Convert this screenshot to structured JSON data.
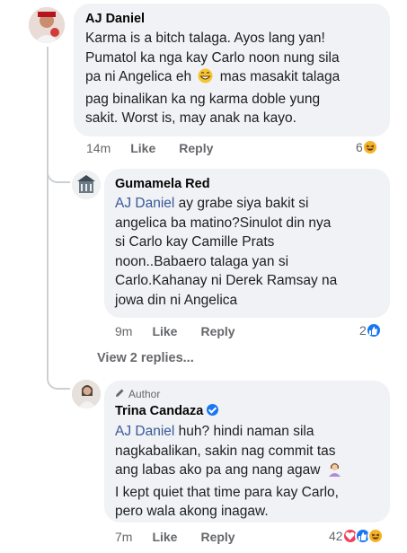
{
  "comments": [
    {
      "name": "AJ Daniel",
      "text_parts": [
        "Karma is a bitch talaga. Ayos lang yan!",
        "Pumatol ka nga kay Carlo noon nung sila",
        "pa ni Angelica eh",
        "mas masakit talaga",
        "pag binalikan ka ng karma doble yung",
        "sakit. Worst is, may anak na kayo."
      ],
      "time": "14m",
      "like_label": "Like",
      "reply_label": "Reply",
      "reaction_count": "6",
      "reaction_icons": [
        "haha"
      ]
    },
    {
      "name": "Gumamela Red",
      "mention": "AJ Daniel",
      "text_lines": [
        " ay grabe siya bakit si",
        "angelica ba matino?Sinulot din nya",
        "si Carlo kay Camille Prats",
        "noon..Babaero talaga yan si",
        "Carlo.Kahanay ni Derek Ramsay na",
        "jowa din ni Angelica"
      ],
      "time": "9m",
      "like_label": "Like",
      "reply_label": "Reply",
      "reaction_count": "2",
      "reaction_icons": [
        "like"
      ]
    },
    {
      "author_tag": "Author",
      "name": "Trina Candaza",
      "verified": true,
      "mention": "AJ Daniel",
      "text_lines": [
        " huh? hindi naman sila",
        "nagkabalikan, sakin nag commit tas",
        "ang labas ako pa ang nang agaw",
        "I kept quiet that time para kay Carlo,",
        "pero wala akong inagaw."
      ],
      "time": "7m",
      "like_label": "Like",
      "reply_label": "Reply",
      "reaction_count": "42",
      "reaction_icons": [
        "love",
        "like",
        "haha"
      ]
    }
  ],
  "view_replies_label": "View 2 replies...",
  "colors": {
    "bubble": "#f0f2f5",
    "mention": "#385898",
    "meta": "#65676b",
    "like_blue": "#1877f2",
    "love_red": "#f33e58",
    "haha_yellow": "#f7b125"
  }
}
